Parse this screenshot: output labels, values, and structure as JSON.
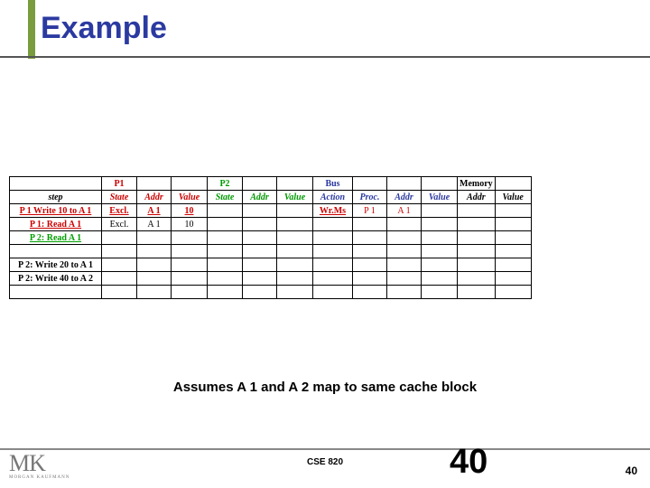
{
  "title": "Example",
  "caption": "Assumes A 1 and A 2 map to same cache block",
  "footer": {
    "course": "CSE 820",
    "big_num": "40",
    "page": "40",
    "logo_mk": "MK",
    "logo_sub": "MORGAN KAUFMANN"
  },
  "groups": {
    "p1": "P1",
    "p2": "P2",
    "bus": "Bus",
    "mem": "Memory"
  },
  "cols": {
    "step": "step",
    "state": "State",
    "addr": "Addr",
    "value": "Value",
    "action": "Action",
    "proc": "Proc."
  },
  "rows": [
    {
      "step": "P 1 Write 10 to A 1",
      "step_cls": "red-u",
      "p1_state": "Excl.",
      "p1_state_cls": "red-u",
      "p1_addr": "A 1",
      "p1_addr_cls": "red-u",
      "p1_value": "10",
      "p1_value_cls": "red-u",
      "p2_state": "",
      "p2_addr": "",
      "p2_value": "",
      "bus_action": "Wr.Ms",
      "bus_action_cls": "red-u",
      "bus_proc": "P 1",
      "bus_proc_cls": "p1h",
      "bus_addr": "A 1",
      "bus_addr_cls": "p1h",
      "bus_value": "",
      "mem_addr": "",
      "mem_value": ""
    },
    {
      "step": "P 1: Read A 1",
      "step_cls": "red-u",
      "p1_state": "Excl.",
      "p1_addr": "A 1",
      "p1_value": "10",
      "p2_state": "",
      "p2_addr": "",
      "p2_value": "",
      "bus_action": "",
      "bus_proc": "",
      "bus_addr": "",
      "bus_value": "",
      "mem_addr": "",
      "mem_value": ""
    },
    {
      "step": "P 2: Read A 1",
      "step_cls": "green-u",
      "p1_state": "",
      "p1_addr": "",
      "p1_value": "",
      "p2_state": "",
      "p2_addr": "",
      "p2_value": "",
      "bus_action": "",
      "bus_proc": "",
      "bus_addr": "",
      "bus_value": "",
      "mem_addr": "",
      "mem_value": ""
    },
    {
      "blank": true
    },
    {
      "step": "P 2: Write 20 to A 1",
      "step_cls": "bkstep",
      "p1_state": "",
      "p1_addr": "",
      "p1_value": "",
      "p2_state": "",
      "p2_addr": "",
      "p2_value": "",
      "bus_action": "",
      "bus_proc": "",
      "bus_addr": "",
      "bus_value": "",
      "mem_addr": "",
      "mem_value": ""
    },
    {
      "step": "P 2: Write 40 to A 2",
      "step_cls": "bkstep",
      "p1_state": "",
      "p1_addr": "",
      "p1_value": "",
      "p2_state": "",
      "p2_addr": "",
      "p2_value": "",
      "bus_action": "",
      "bus_proc": "",
      "bus_addr": "",
      "bus_value": "",
      "mem_addr": "",
      "mem_value": ""
    },
    {
      "blank": true
    }
  ]
}
